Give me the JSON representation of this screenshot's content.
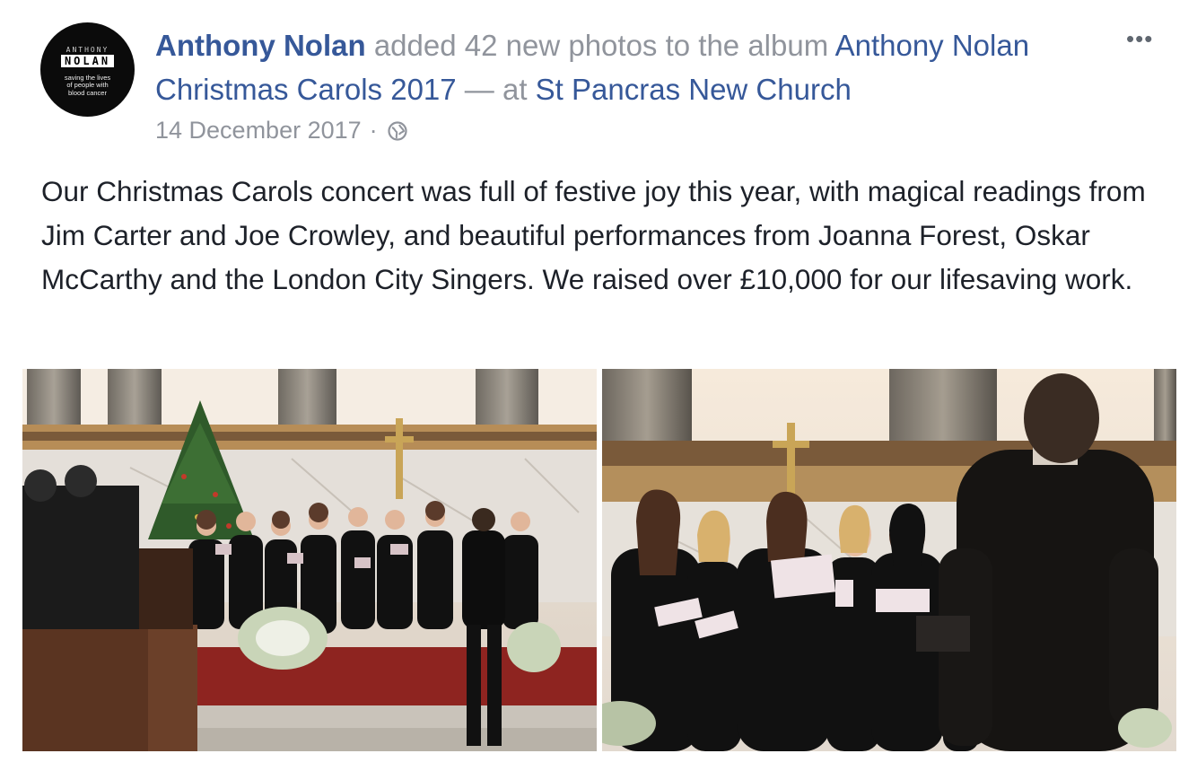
{
  "post": {
    "author_avatar": {
      "logo_top": "ANTHONY",
      "logo_main": "NOLAN",
      "tagline_1": "saving the lives",
      "tagline_2": "of people with",
      "tagline_3": "blood cancer"
    },
    "author": "Anthony Nolan",
    "action_text": "added 42 new photos to the album",
    "album_name": "Anthony Nolan Christmas Carols 2017",
    "location_prefix": "— at",
    "location": "St Pancras New Church",
    "date": "14 December 2017",
    "separator": "·",
    "privacy_icon": "globe-icon",
    "more_label": "•••",
    "text": "Our Christmas Carols concert was full of festive joy this year, with magical readings from Jim Carter and Joe Crowley, and beautiful performances from Joanna Forest, Oskar McCarthy and the London City Singers. We raised over £10,000 for our lifesaving work."
  },
  "colors": {
    "link": "#365899",
    "meta_gray": "#90949c",
    "text": "#1d2129"
  }
}
